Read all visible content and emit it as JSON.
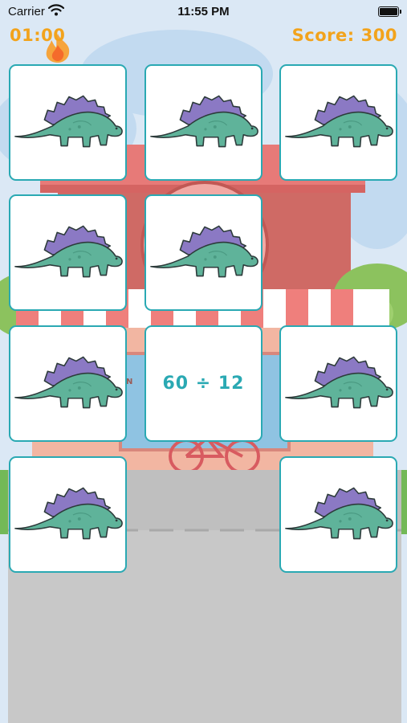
{
  "status_bar": {
    "carrier": "Carrier",
    "time": "11:55 PM",
    "wifi_icon": "wifi-icon",
    "battery_icon": "battery-icon"
  },
  "game": {
    "timer": "01:00",
    "score_label": "Score:",
    "score_value": "300",
    "accent_color": "#f2a31c",
    "card_border_color": "#2aa9b3",
    "cards": [
      {
        "state": "face-down",
        "icon": "stegosaurus-icon"
      },
      {
        "state": "face-down",
        "icon": "stegosaurus-icon"
      },
      {
        "state": "face-down",
        "icon": "stegosaurus-icon"
      },
      {
        "state": "face-down",
        "icon": "stegosaurus-icon"
      },
      {
        "state": "face-down",
        "icon": "stegosaurus-icon"
      },
      {
        "state": "empty"
      },
      {
        "state": "face-down",
        "icon": "stegosaurus-icon"
      },
      {
        "state": "face-up",
        "text": "60 ÷ 12"
      },
      {
        "state": "face-down",
        "icon": "stegosaurus-icon"
      },
      {
        "state": "face-down",
        "icon": "stegosaurus-icon"
      },
      {
        "state": "empty"
      },
      {
        "state": "face-down",
        "icon": "stegosaurus-icon"
      }
    ]
  },
  "background": {
    "scene": "street-shop-background",
    "sign_fragment": "N"
  }
}
